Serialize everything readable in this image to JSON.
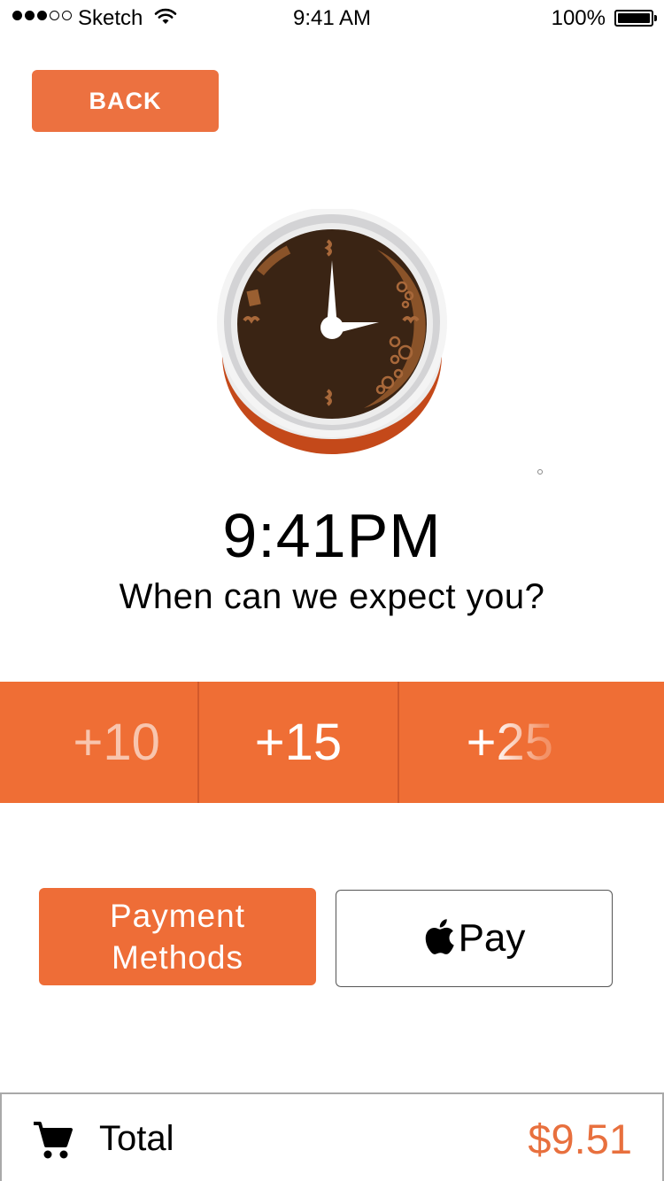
{
  "status_bar": {
    "carrier": "Sketch",
    "time": "9:41 AM",
    "battery": "100%",
    "signal_bars_filled": 3,
    "signal_bars_total": 5
  },
  "header": {
    "back_label": "BACK"
  },
  "main": {
    "pickup_time": "9:41PM",
    "question": "When can we expect you?"
  },
  "increments": [
    {
      "label": "+10"
    },
    {
      "label": "+15",
      "selected": true
    },
    {
      "label": "+25"
    }
  ],
  "payment": {
    "methods_line1": "Payment",
    "methods_line2": "Methods",
    "apple_pay_label": "Pay"
  },
  "total": {
    "label": "Total",
    "amount": "$9.51"
  },
  "colors": {
    "accent": "#ee6d37",
    "coffee": "#3a2414",
    "cup_base": "#c4491a",
    "amount": "#e8703e"
  },
  "icons": [
    "signal-icon",
    "wifi-icon",
    "battery-icon",
    "clock-cup-icon",
    "apple-logo-icon",
    "cart-icon"
  ]
}
